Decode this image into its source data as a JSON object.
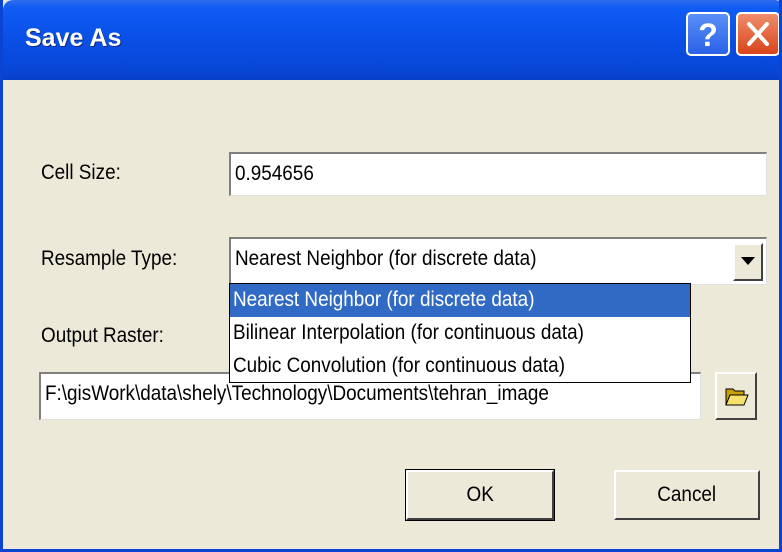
{
  "window": {
    "title": "Save As",
    "help_label": "?"
  },
  "form": {
    "cell_size": {
      "label": "Cell Size:",
      "value": "0.954656"
    },
    "resample_type": {
      "label": "Resample Type:",
      "value": "Nearest Neighbor (for discrete data)",
      "options": [
        "Nearest Neighbor (for discrete data)",
        "Bilinear Interpolation (for continuous data)",
        "Cubic Convolution (for continuous data)"
      ]
    },
    "output_raster": {
      "label": "Output Raster:",
      "value": "F:\\gisWork\\data\\shely\\Technology\\Documents\\tehran_image"
    }
  },
  "buttons": {
    "ok": "OK",
    "cancel": "Cancel"
  },
  "colors": {
    "title_bar": "#0a4fe6",
    "selection": "#316ac5",
    "dialog_bg": "#ece9d8",
    "close": "#d8451a"
  }
}
